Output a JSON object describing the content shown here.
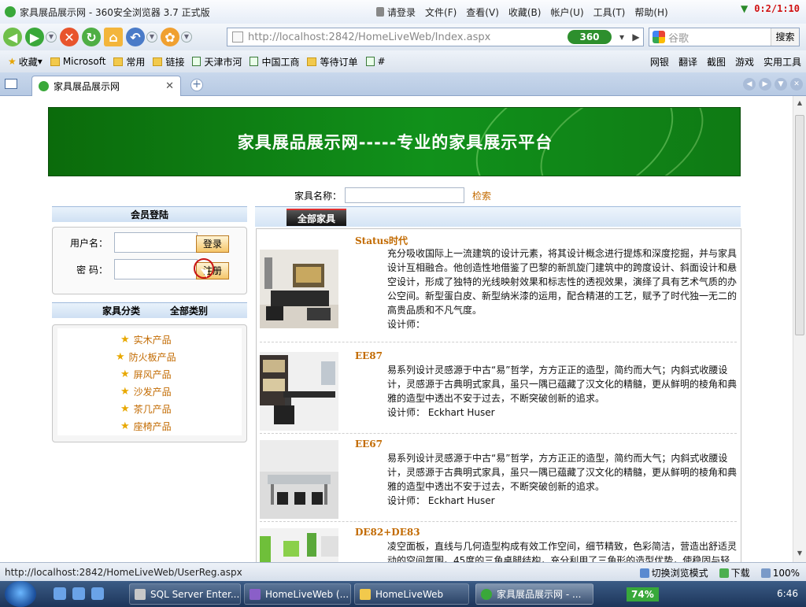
{
  "window": {
    "title": "家具展品展示网 - 360安全浏览器 3.7 正式版",
    "menus": [
      "请登录",
      "文件(F)",
      "查看(V)",
      "收藏(B)",
      "帐户(U)",
      "工具(T)",
      "帮助(H)"
    ],
    "timer": "0:2/1:10"
  },
  "address": {
    "url": "http://localhost:2842/HomeLiveWeb/Index.aspx",
    "brand": "360",
    "search_placeholder": "谷歌",
    "search_button": "搜索"
  },
  "favorites": {
    "items": [
      "收藏",
      "Microsoft",
      "常用",
      "链接",
      "天津市河",
      "中国工商",
      "等待订单",
      "#"
    ],
    "right": [
      "网银",
      "翻译",
      "截图",
      "游戏",
      "实用工具"
    ]
  },
  "tab": {
    "title": "家具展品展示网"
  },
  "page": {
    "banner_title": "家具展品展示网-----专业的家具展示平台",
    "search_label": "家具名称：",
    "search_button": "检索",
    "login": {
      "header": "会员登陆",
      "username_label": "用户名：",
      "password_label": "密  码：",
      "login_button": "登录",
      "register_button": "注册"
    },
    "categories": {
      "header_left": "家具分类",
      "header_right": "全部类别",
      "items": [
        "实木产品",
        "防火板产品",
        "屏风产品",
        "沙发产品",
        "茶几产品",
        "座椅产品"
      ]
    },
    "main": {
      "tab_label": "全部家具",
      "products": [
        {
          "name": "Status时代",
          "desc": "充分吸收国际上一流建筑的设计元素，将其设计概念进行提炼和深度挖掘，并与家具设计互相融合。他创造性地借鉴了巴黎的新凯旋门建筑中的跨度设计、斜面设计和悬空设计，形成了独特的光线映射效果和标志性的透视效果，演绎了具有艺术气质的办公空间。新型蛋白皮、新型纳米漆的运用，配合精湛的工艺，赋予了时代独一无二的高贵品质和不凡气度。",
          "designer": "设计师："
        },
        {
          "name": "EE87",
          "desc": "易系列设计灵感源于中古“易”哲学，方方正正的造型，简约而大气；内斜式收腰设计，灵感源于古典明式家具，虽只一隅已蕴藏了汉文化的精髓，更从鲜明的棱角和典雅的造型中透出不安于过去，不断突破创新的追求。",
          "designer": "设计师： Eckhart Huser"
        },
        {
          "name": "EE67",
          "desc": "易系列设计灵感源于中古“易”哲学，方方正正的造型，简约而大气；内斜式收腰设计，灵感源于古典明式家具，虽只一隅已蕴藏了汉文化的精髓，更从鲜明的棱角和典雅的造型中透出不安于过去，不断突破创新的追求。",
          "designer": "设计师： Eckhart Huser"
        },
        {
          "name": "DE82+DE83",
          "desc": "凌空面板，直线与几何造型构成有效工作空间，细节精致，色彩简洁，营造出舒适灵动的空间氛围。45度的三角桌腿结构，充分利用了三角形的造型优势，使稳固与轻巧",
          "designer": ""
        }
      ]
    }
  },
  "status": {
    "url": "http://localhost:2842/HomeLiveWeb/UserReg.aspx",
    "mode": "切换浏览模式",
    "download": "下载",
    "zoom": "100%"
  },
  "taskbar": {
    "items": [
      "SQL Server Enter...",
      "HomeLiveWeb (...",
      "HomeLiveWeb",
      "家具展品展示网 - ..."
    ],
    "battery": "74%",
    "clock": "6:46"
  }
}
